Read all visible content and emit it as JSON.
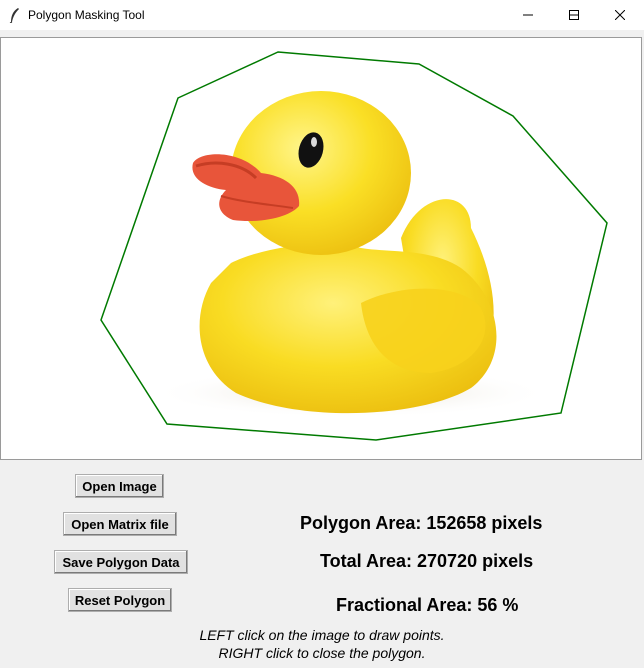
{
  "window": {
    "title": "Polygon Masking Tool"
  },
  "buttons": {
    "open_image": "Open Image",
    "open_matrix": "Open Matrix file",
    "save_polygon": "Save Polygon Data",
    "reset_polygon": "Reset Polygon"
  },
  "stats": {
    "polygon_area": "Polygon Area: 152658 pixels",
    "total_area": "Total Area: 270720 pixels",
    "fractional_area": "Fractional Area: 56 %"
  },
  "instructions": {
    "line1": "LEFT click on the image to draw points.",
    "line2": "RIGHT click to close the polygon."
  },
  "colors": {
    "polygon_stroke": "#007a00",
    "duck": "#f8d61e",
    "beak": "#e8553a"
  },
  "icons": [
    "feather-icon",
    "minimize-icon",
    "maximize-icon",
    "close-icon"
  ]
}
